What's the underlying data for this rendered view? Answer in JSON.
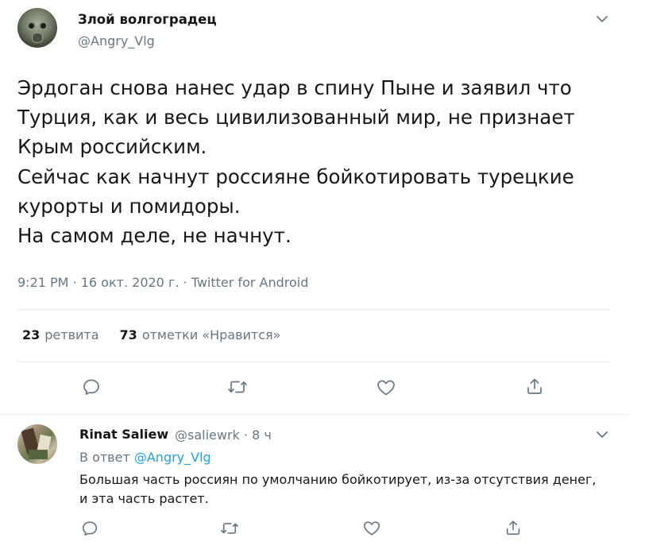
{
  "tweet": {
    "author_name": "Злой волгоградец",
    "author_handle": "@Angry_Vlg",
    "text": "Эрдоган снова нанес удар в спину Пыне и заявил что Турция, как и весь цивилизованный мир, не признает Крым российским.\nСейчас как начнут россияне бойкотировать турецкие курорты и помидоры.\nНа самом деле, не начнут.",
    "time": "9:21 PM",
    "date": "16 окт. 2020 г.",
    "source": "Twitter for Android",
    "meta_sep": "·",
    "retweets_count": "23",
    "retweets_label": "ретвита",
    "likes_count": "73",
    "likes_label": "отметки «Нравится»"
  },
  "reply": {
    "author_name": "Rinat Saliew",
    "author_handle": "@saliewrk",
    "sep": "·",
    "age": "8 ч",
    "reply_prefix": "В ответ",
    "reply_to_handle": "@Angry_Vlg",
    "text": "Большая часть россиян по умолчанию бойкотирует, из-за отсутствия денег, и эта часть растет."
  },
  "icons": {
    "reply": "speech-bubble-icon",
    "retweet": "retweet-arrows-icon",
    "like": "heart-icon",
    "share": "share-upload-icon",
    "menu": "chevron-down-icon"
  },
  "colors": {
    "text": "#14171a",
    "secondary": "#657786",
    "link": "#1da1f2",
    "divider": "#e6ecf0"
  }
}
